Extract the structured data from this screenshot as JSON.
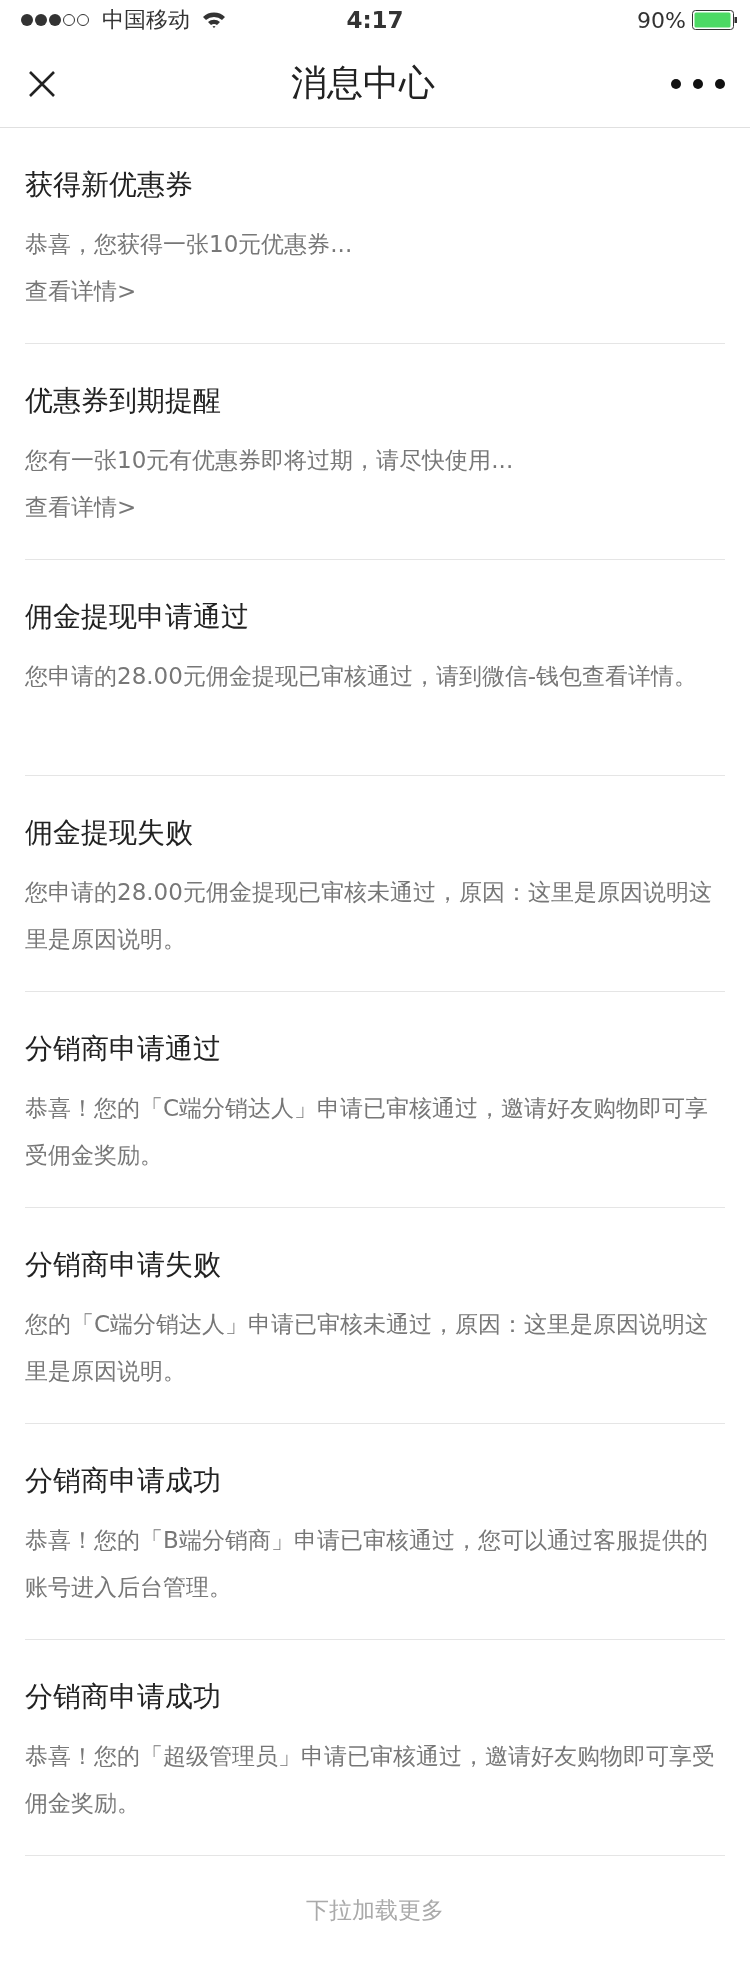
{
  "status_bar": {
    "carrier": "中国移动",
    "time": "4:17",
    "battery": "90%"
  },
  "nav": {
    "title": "消息中心"
  },
  "messages": [
    {
      "title": "获得新优惠券",
      "body": "恭喜，您获得一张10元优惠券...",
      "link": "查看详情>"
    },
    {
      "title": "优惠券到期提醒",
      "body": "您有一张10元有优惠券即将过期，请尽快使用...",
      "link": "查看详情>"
    },
    {
      "title": "佣金提现申请通过",
      "body": "您申请的28.00元佣金提现已审核通过，请到微信-钱包查看详情。"
    },
    {
      "title": "佣金提现失败",
      "body": "您申请的28.00元佣金提现已审核未通过，原因：这里是原因说明这里是原因说明。"
    },
    {
      "title": "分销商申请通过",
      "body": "恭喜！您的「C端分销达人」申请已审核通过，邀请好友购物即可享受佣金奖励。"
    },
    {
      "title": "分销商申请失败",
      "body": "您的「C端分销达人」申请已审核未通过，原因：这里是原因说明这里是原因说明。"
    },
    {
      "title": "分销商申请成功",
      "body": "恭喜！您的「B端分销商」申请已审核通过，您可以通过客服提供的账号进入后台管理。"
    },
    {
      "title": "分销商申请成功",
      "body": "恭喜！您的「超级管理员」申请已审核通过，邀请好友购物即可享受佣金奖励。"
    }
  ],
  "footer": "下拉加载更多"
}
